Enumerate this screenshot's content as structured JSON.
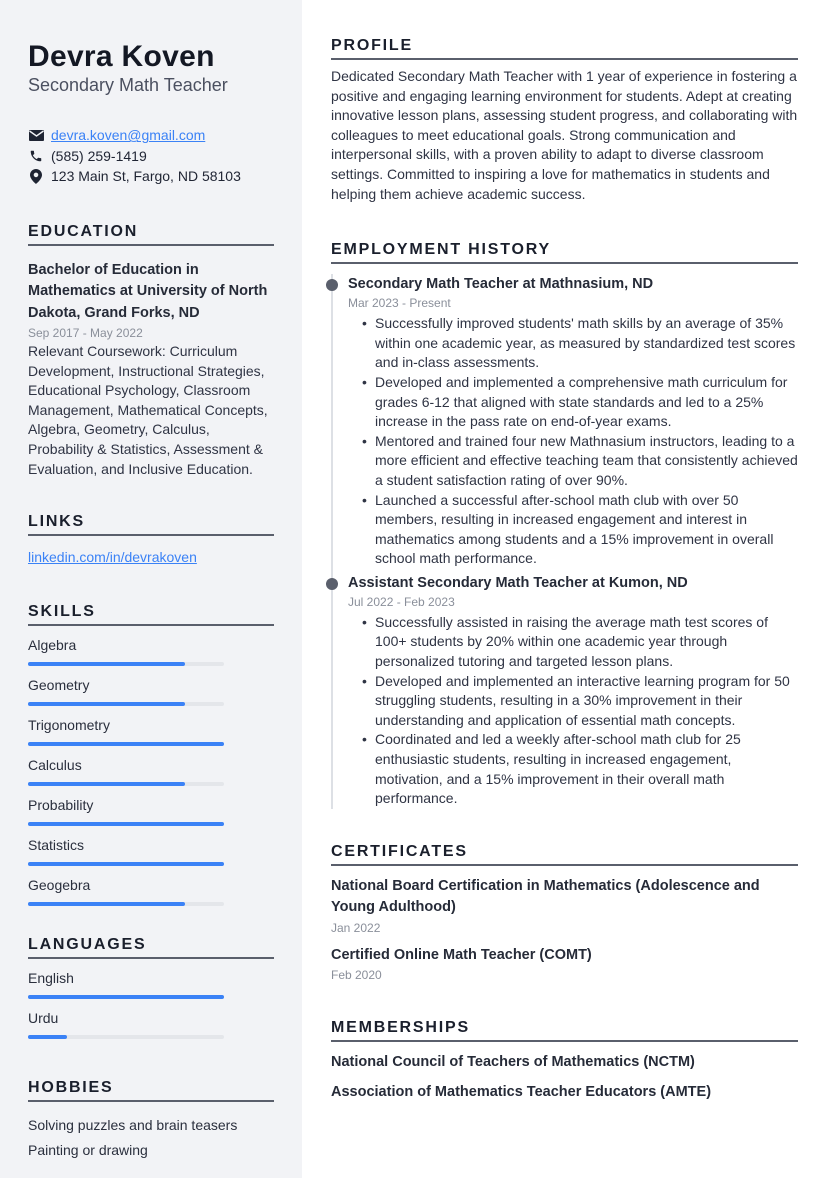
{
  "header": {
    "name": "Devra Koven",
    "title": "Secondary Math Teacher"
  },
  "contacts": {
    "email": "devra.koven@gmail.com",
    "phone": "(585) 259-1419",
    "address": "123 Main St, Fargo, ND 58103",
    "icons": [
      "envelope-icon",
      "phone-icon",
      "map-pin-icon"
    ]
  },
  "education": {
    "heading": "EDUCATION",
    "degree": "Bachelor of Education in Mathematics at University of North Dakota, Grand Forks, ND",
    "dates": "Sep 2017 - May 2022",
    "description": "Relevant Coursework: Curriculum Development, Instructional Strategies, Educational Psychology, Classroom Management, Mathematical Concepts, Algebra, Geometry, Calculus, Probability & Statistics, Assessment & Evaluation, and Inclusive Education."
  },
  "links": {
    "heading": "LINKS",
    "items": [
      "linkedin.com/in/devrakoven"
    ]
  },
  "skills": {
    "heading": "SKILLS",
    "items": [
      {
        "label": "Algebra",
        "level": 0.8
      },
      {
        "label": "Geometry",
        "level": 0.8
      },
      {
        "label": "Trigonometry",
        "level": 1.0
      },
      {
        "label": "Calculus",
        "level": 0.8
      },
      {
        "label": "Probability",
        "level": 1.0
      },
      {
        "label": "Statistics",
        "level": 1.0
      },
      {
        "label": "Geogebra",
        "level": 0.8
      }
    ]
  },
  "languages": {
    "heading": "LANGUAGES",
    "items": [
      {
        "label": "English",
        "level": 1.0
      },
      {
        "label": "Urdu",
        "level": 0.2
      }
    ]
  },
  "hobbies": {
    "heading": "HOBBIES",
    "items": [
      "Solving puzzles and brain teasers",
      "Painting or drawing"
    ]
  },
  "profile": {
    "heading": "PROFILE",
    "text": "Dedicated Secondary Math Teacher with 1 year of experience in fostering a positive and engaging learning environment for students. Adept at creating innovative lesson plans, assessing student progress, and collaborating with colleagues to meet educational goals. Strong communication and interpersonal skills, with a proven ability to adapt to diverse classroom settings. Committed to inspiring a love for mathematics in students and helping them achieve academic success."
  },
  "employment": {
    "heading": "EMPLOYMENT HISTORY",
    "jobs": [
      {
        "title": "Secondary Math Teacher at Mathnasium, ND",
        "dates": "Mar 2023 - Present",
        "bullets": [
          "Successfully improved students' math skills by an average of 35% within one academic year, as measured by standardized test scores and in-class assessments.",
          "Developed and implemented a comprehensive math curriculum for grades 6-12 that aligned with state standards and led to a 25% increase in the pass rate on end-of-year exams.",
          "Mentored and trained four new Mathnasium instructors, leading to a more efficient and effective teaching team that consistently achieved a student satisfaction rating of over 90%.",
          "Launched a successful after-school math club with over 50 members, resulting in increased engagement and interest in mathematics among students and a 15% improvement in overall school math performance."
        ]
      },
      {
        "title": "Assistant Secondary Math Teacher at Kumon, ND",
        "dates": "Jul 2022 - Feb 2023",
        "bullets": [
          "Successfully assisted in raising the average math test scores of 100+ students by 20% within one academic year through personalized tutoring and targeted lesson plans.",
          "Developed and implemented an interactive learning program for 50 struggling students, resulting in a 30% improvement in their understanding and application of essential math concepts.",
          "Coordinated and led a weekly after-school math club for 25 enthusiastic students, resulting in increased engagement, motivation, and a 15% improvement in their overall math performance."
        ]
      }
    ]
  },
  "certificates": {
    "heading": "CERTIFICATES",
    "items": [
      {
        "title": "National Board Certification in Mathematics (Adolescence and Young Adulthood)",
        "date": "Jan 2022"
      },
      {
        "title": "Certified Online Math Teacher (COMT)",
        "date": "Feb 2020"
      }
    ]
  },
  "memberships": {
    "heading": "MEMBERSHIPS",
    "items": [
      "National Council of Teachers of Mathematics (NCTM)",
      "Association of Mathematics Teacher Educators (AMTE)"
    ]
  },
  "colors": {
    "accent": "#3b82f6",
    "sidebar_bg": "#f2f3f6",
    "text": "#1f2433",
    "muted": "#8a8f9a"
  }
}
